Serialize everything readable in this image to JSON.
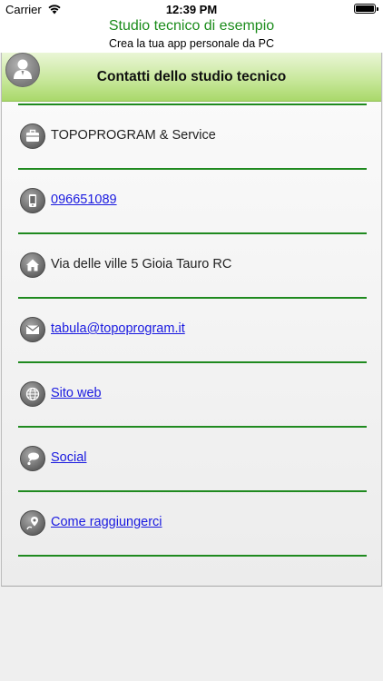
{
  "status_bar": {
    "carrier": "Carrier",
    "time": "12:39 PM"
  },
  "header": {
    "title": "Studio tecnico di esempio",
    "subtitle": "Crea la tua app personale da PC"
  },
  "panel": {
    "title": "Contatti dello studio tecnico"
  },
  "contacts": [
    {
      "icon": "briefcase-icon",
      "text": "TOPOPROGRAM & Service",
      "link": false
    },
    {
      "icon": "phone-icon",
      "text": "096651089",
      "link": true
    },
    {
      "icon": "home-icon",
      "text": "Via delle ville 5 Gioia Tauro RC",
      "link": false
    },
    {
      "icon": "mail-icon",
      "text": "tabula@topoprogram.it",
      "link": true
    },
    {
      "icon": "globe-icon",
      "text": "Sito web",
      "link": true
    },
    {
      "icon": "social-icon",
      "text": "Social",
      "link": true
    },
    {
      "icon": "map-pin-icon",
      "text": "Come raggiungerci",
      "link": true
    }
  ],
  "colors": {
    "accent_green": "#1b8c1b",
    "link_blue": "#1a1ae0",
    "title_bar_green": "#b9e07f"
  }
}
